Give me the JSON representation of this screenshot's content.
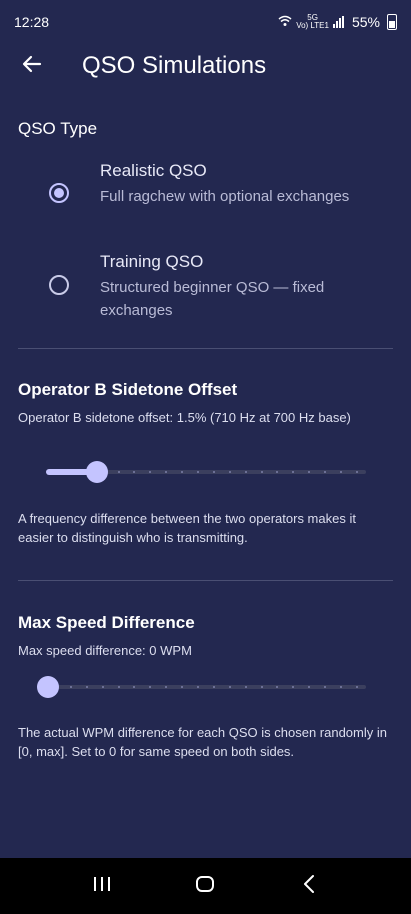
{
  "status": {
    "time": "12:28",
    "net_top": "5G",
    "net_bottom": "Vo) LTE1",
    "battery": "55%"
  },
  "header": {
    "title": "QSO Simulations"
  },
  "qso_type": {
    "title": "QSO Type",
    "options": [
      {
        "label": "Realistic QSO",
        "description": "Full ragchew with optional exchanges",
        "selected": true
      },
      {
        "label": "Training QSO",
        "description": "Structured beginner QSO — fixed exchanges",
        "selected": false
      }
    ]
  },
  "sidetone": {
    "title": "Operator B Sidetone Offset",
    "value_text": "Operator B sidetone offset: 1.5%  (710 Hz at 700 Hz base)",
    "slider_fraction": 0.155,
    "help": "A frequency difference between the two operators makes it easier to distinguish who is transmitting."
  },
  "speed": {
    "title": "Max Speed Difference",
    "value_text": "Max speed difference: 0 WPM",
    "slider_fraction": 0,
    "help": "The actual WPM difference for each QSO is chosen randomly in [0, max]. Set to 0 for same speed on both sides."
  },
  "colors": {
    "background": "#232850",
    "accent": "#c4c4ff",
    "divider": "#4a4f73"
  },
  "icons": {
    "back": "arrow-left-icon",
    "recents": "recents-icon",
    "home": "home-icon",
    "nav_back": "chevron-left-icon"
  }
}
